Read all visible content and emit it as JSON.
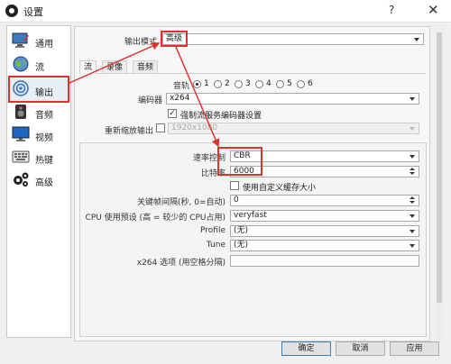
{
  "window": {
    "title": "设置",
    "help": "?",
    "close": "✕"
  },
  "sidebar": {
    "items": [
      {
        "label": "通用",
        "icon": "monitor-icon"
      },
      {
        "label": "流",
        "icon": "globe-icon"
      },
      {
        "label": "输出",
        "icon": "broadcast-icon"
      },
      {
        "label": "音频",
        "icon": "speaker-icon"
      },
      {
        "label": "视频",
        "icon": "display-icon"
      },
      {
        "label": "热键",
        "icon": "keyboard-icon"
      },
      {
        "label": "高级",
        "icon": "gears-icon"
      }
    ],
    "active_index": 2
  },
  "output": {
    "mode_label": "输出模式",
    "mode_value": "高级",
    "tabs": [
      "流",
      "录像",
      "音频"
    ],
    "active_tab": 0,
    "track_label": "音轨",
    "tracks": [
      "1",
      "2",
      "3",
      "4",
      "5",
      "6"
    ],
    "selected_track": 0,
    "encoder_label": "编码器",
    "encoder_value": "x264",
    "enforce_label": "强制流服务编码器设置",
    "enforce_checked": true,
    "rescale_label": "重新缩放输出",
    "rescale_checked": false,
    "rescale_value": "1920x1080"
  },
  "encoder_settings": {
    "rate_control_label": "速率控制",
    "rate_control_value": "CBR",
    "bitrate_label": "比特率",
    "bitrate_value": "6000",
    "custom_buffer_label": "使用自定义缓存大小",
    "custom_buffer_checked": false,
    "keyframe_label": "关键帧间隔(秒, 0=自动)",
    "keyframe_value": "0",
    "cpu_preset_label": "CPU 使用预设 (高 = 较少的 CPU占用)",
    "cpu_preset_value": "veryfast",
    "profile_label": "Profile",
    "profile_value": "(无)",
    "tune_label": "Tune",
    "tune_value": "(无)",
    "x264_options_label": "x264 选项 (用空格分隔)",
    "x264_options_value": ""
  },
  "buttons": {
    "ok": "确定",
    "cancel": "取消",
    "apply": "应用"
  },
  "colors": {
    "highlight": "#e0312f",
    "accent": "#3c7fb1"
  }
}
